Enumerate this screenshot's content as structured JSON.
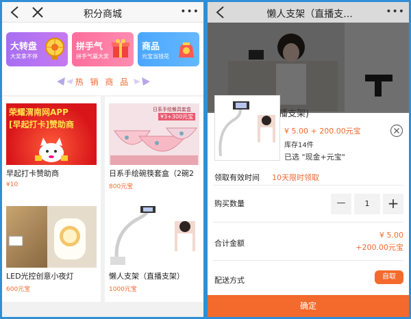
{
  "left": {
    "title": "积分商城",
    "more": "•••",
    "banners": [
      {
        "title": "大转盘",
        "subtitle": "大奖拿不停"
      },
      {
        "title": "拼手气",
        "subtitle": "拼手气赢大奖"
      },
      {
        "title": "商品",
        "subtitle": "元宝当钱花"
      }
    ],
    "section_title": "热 销 商 品",
    "products": [
      {
        "name": "早起打卡赞助商",
        "price": "¥10",
        "img_text_1": "荣耀渭南网APP",
        "img_text_2": "[早起打卡]赞助商"
      },
      {
        "name": "日系手绘碗筷套盒（2碗2",
        "price": "800元宝",
        "img_text_1": "日系手绘餐具套盒",
        "img_text_2": "¥3+300元宝"
      },
      {
        "name": "LED光控创意小夜灯",
        "price": "600元宝"
      },
      {
        "name": "懒人支架（直播支架）",
        "price": "1000元宝"
      }
    ]
  },
  "right": {
    "title": "懒人支架（直播支...",
    "more": "•••",
    "partial_title": "播支架)",
    "price_line": "¥ 5.00 + 200.00元宝",
    "stock": "库存14件",
    "chosen": "已选 \"现金+元宝\"",
    "valid_label": "领取有效时间",
    "valid_value": "10天限时领取",
    "qty_label": "购买数量",
    "qty_minus": "—",
    "qty_value": "1",
    "qty_plus": "+",
    "total_label": "合计金额",
    "total_cash": "¥ 5.00",
    "total_points": "+200.00元宝",
    "ship_label": "配送方式",
    "ship_value": "自取",
    "confirm": "确定"
  },
  "colors": {
    "accent": "#f36a2c",
    "frame": "#2f8fd6"
  }
}
